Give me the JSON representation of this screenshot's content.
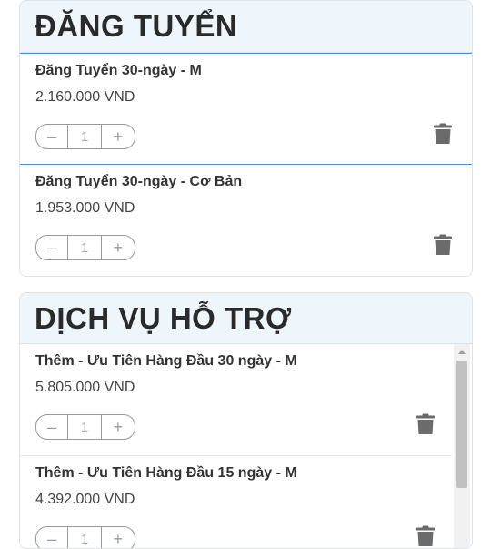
{
  "sections": [
    {
      "title": "ĐĂNG TUYỂN",
      "items": [
        {
          "name": "Đăng Tuyển 30-ngày - M",
          "price": "2.160.000 VND",
          "qty": "1",
          "selected": true
        },
        {
          "name": "Đăng Tuyển 30-ngày - Cơ Bản",
          "price": "1.953.000 VND",
          "qty": "1",
          "selected": false
        }
      ]
    },
    {
      "title": "DỊCH VỤ HỖ TRỢ",
      "items": [
        {
          "name": "Thêm - Ưu Tiên Hàng Đầu 30 ngày - M",
          "price": "5.805.000 VND",
          "qty": "1"
        },
        {
          "name": "Thêm - Ưu Tiên Hàng Đầu 15 ngày - M",
          "price": "4.392.000 VND",
          "qty": "1"
        }
      ]
    }
  ],
  "controls": {
    "minus": "–",
    "plus": "+"
  },
  "icons": {
    "delete": "trash-icon",
    "scroll_up": "chevron-up-icon"
  },
  "colors": {
    "header_bg": "#eef5fb",
    "selected_border": "#4a8fd4",
    "icon": "#6b6b6b"
  }
}
